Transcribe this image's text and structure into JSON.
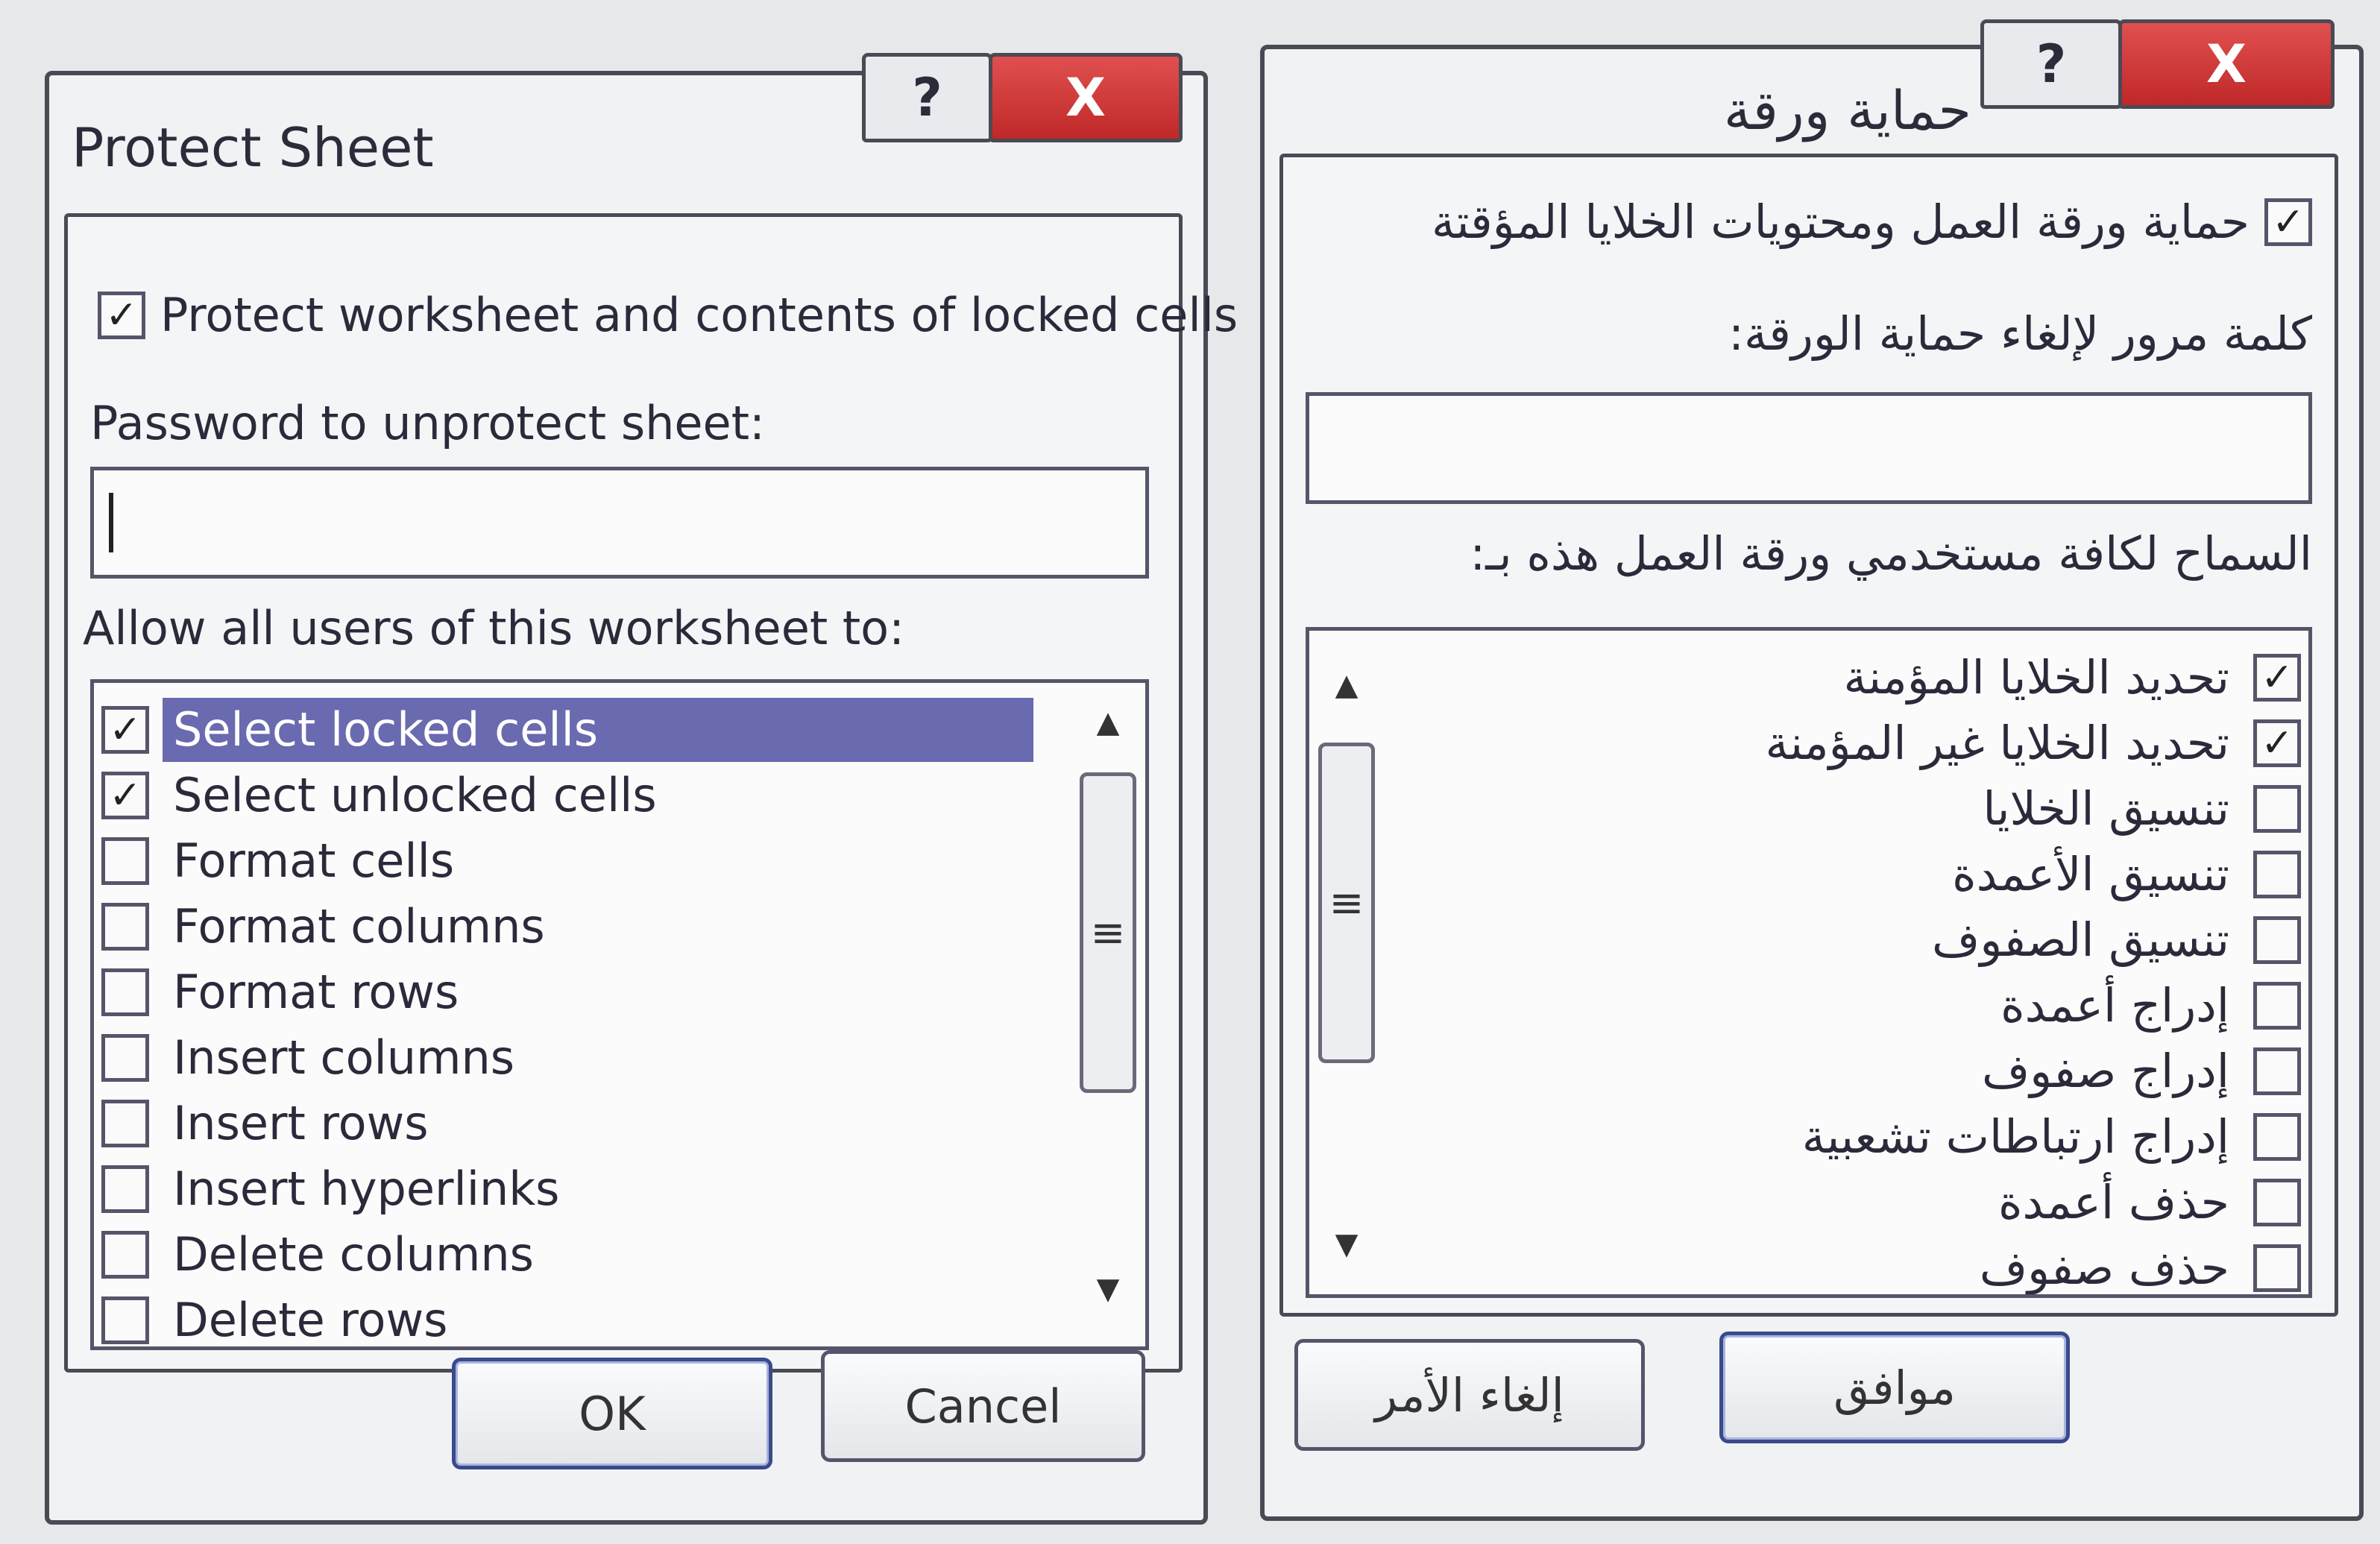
{
  "english_dialog": {
    "title": "Protect Sheet",
    "help_button": "?",
    "close_button": "X",
    "protect_checkbox": {
      "label": "Protect worksheet and contents of locked cells",
      "checked": true
    },
    "password_label": "Password to unprotect sheet:",
    "password_value": "",
    "allow_label": "Allow all users of this worksheet to:",
    "permissions": [
      {
        "label": "Select locked cells",
        "checked": true,
        "selected": true
      },
      {
        "label": "Select unlocked cells",
        "checked": true,
        "selected": false
      },
      {
        "label": "Format cells",
        "checked": false,
        "selected": false
      },
      {
        "label": "Format columns",
        "checked": false,
        "selected": false
      },
      {
        "label": "Format rows",
        "checked": false,
        "selected": false
      },
      {
        "label": "Insert columns",
        "checked": false,
        "selected": false
      },
      {
        "label": "Insert rows",
        "checked": false,
        "selected": false
      },
      {
        "label": "Insert hyperlinks",
        "checked": false,
        "selected": false
      },
      {
        "label": "Delete columns",
        "checked": false,
        "selected": false
      },
      {
        "label": "Delete rows",
        "checked": false,
        "selected": false
      }
    ],
    "ok_label": "OK",
    "cancel_label": "Cancel"
  },
  "arabic_dialog": {
    "title": "حماية ورقة",
    "help_button": "?",
    "close_button": "X",
    "protect_checkbox": {
      "label": "حماية ورقة العمل ومحتويات الخلايا المؤقتة",
      "checked": true
    },
    "password_label": "كلمة مرور لإلغاء حماية الورقة:",
    "password_value": "",
    "allow_label": "السماح لكافة مستخدمي ورقة العمل هذه بـ:",
    "permissions": [
      {
        "label": "تحديد الخلايا المؤمنة",
        "checked": true,
        "selected": true
      },
      {
        "label": "تحديد الخلايا غير المؤمنة",
        "checked": true,
        "selected": false
      },
      {
        "label": "تنسيق الخلايا",
        "checked": false,
        "selected": false
      },
      {
        "label": "تنسيق الأعمدة",
        "checked": false,
        "selected": false
      },
      {
        "label": "تنسيق الصفوف",
        "checked": false,
        "selected": false
      },
      {
        "label": "إدراج أعمدة",
        "checked": false,
        "selected": false
      },
      {
        "label": "إدراج صفوف",
        "checked": false,
        "selected": false
      },
      {
        "label": "إدراج ارتباطات تشعبية",
        "checked": false,
        "selected": false
      },
      {
        "label": "حذف أعمدة",
        "checked": false,
        "selected": false
      },
      {
        "label": "حذف صفوف",
        "checked": false,
        "selected": false
      }
    ],
    "ok_label": "موافق",
    "cancel_label": "إلغاء الأمر"
  },
  "icons": {
    "checkmark": "✓",
    "scroll_up": "▲",
    "scroll_down": "▼",
    "scroll_grip": "≡"
  },
  "colors": {
    "selection": "#6a6ab0",
    "close_button": "#d03838"
  }
}
